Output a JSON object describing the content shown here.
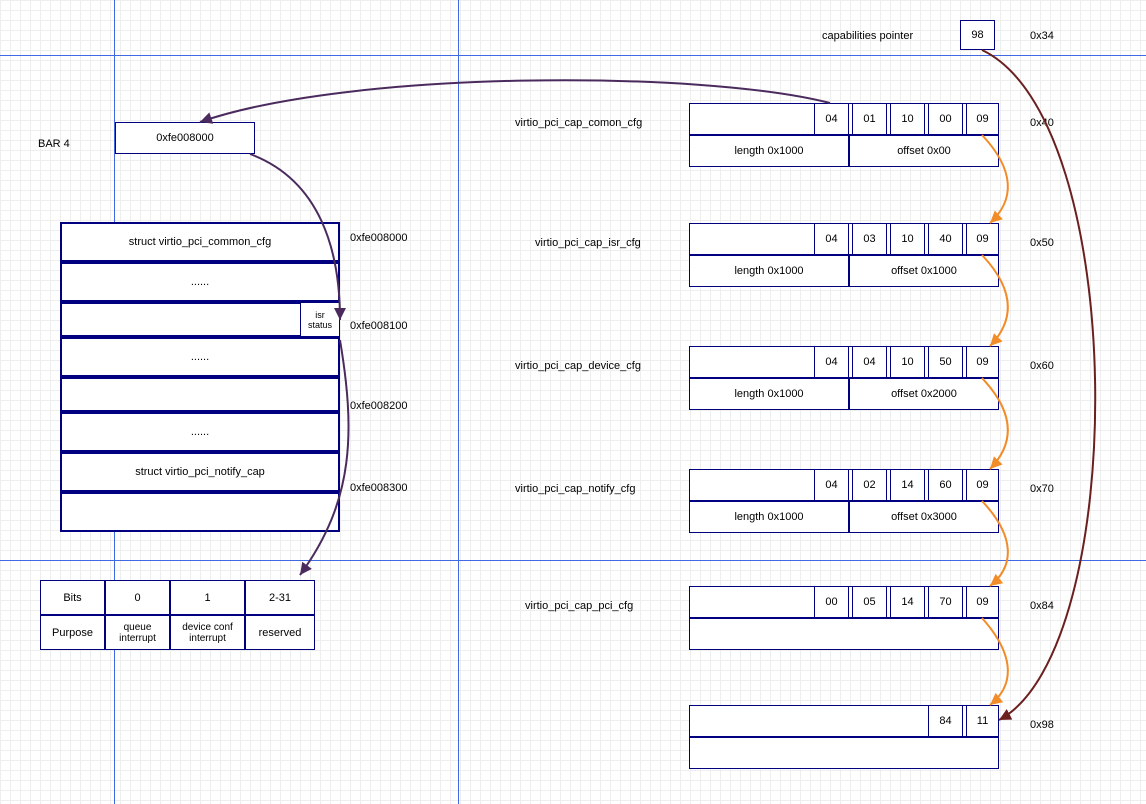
{
  "axes": {
    "h1": 55,
    "h2": 560,
    "v1": 114,
    "v2": 458
  },
  "cap_ptr": {
    "label": "capabilities pointer",
    "value": "98",
    "addr": "0x34"
  },
  "bar4": {
    "label": "BAR 4",
    "value": "0xfe008000"
  },
  "struct_rows": [
    {
      "text": "struct virtio_pci_common_cfg",
      "addr": "0xfe008000"
    },
    {
      "text": "......",
      "addr": ""
    },
    {
      "text": "",
      "addr": "0xfe008100",
      "isr": "isr status"
    },
    {
      "text": "......",
      "addr": ""
    },
    {
      "text": "",
      "addr": "0xfe008200"
    },
    {
      "text": "......",
      "addr": ""
    },
    {
      "text": "struct virtio_pci_notify_cap",
      "addr": "0xfe008300"
    },
    {
      "text": "",
      "addr": ""
    }
  ],
  "bits_table": {
    "headers": [
      "Bits",
      "0",
      "1",
      "2-31"
    ],
    "row": [
      "Purpose",
      "queue interrupt",
      "device conf interrupt",
      "reserved"
    ]
  },
  "caps": [
    {
      "label": "virtio_pci_cap_comon_cfg",
      "addr": "0x40",
      "cells": [
        "04",
        "01",
        "10",
        "00",
        "09"
      ],
      "length": "length 0x1000",
      "offset": "offset 0x00"
    },
    {
      "label": "virtio_pci_cap_isr_cfg",
      "addr": "0x50",
      "cells": [
        "04",
        "03",
        "10",
        "40",
        "09"
      ],
      "length": "length 0x1000",
      "offset": "offset 0x1000"
    },
    {
      "label": "virtio_pci_cap_device_cfg",
      "addr": "0x60",
      "cells": [
        "04",
        "04",
        "10",
        "50",
        "09"
      ],
      "length": "length 0x1000",
      "offset": "offset 0x2000"
    },
    {
      "label": "virtio_pci_cap_notify_cfg",
      "addr": "0x70",
      "cells": [
        "04",
        "02",
        "14",
        "60",
        "09"
      ],
      "length": "length 0x1000",
      "offset": "offset 0x3000"
    },
    {
      "label": "virtio_pci_cap_pci_cfg",
      "addr": "0x84",
      "cells": [
        "00",
        "05",
        "14",
        "70",
        "09"
      ],
      "length": "",
      "offset": ""
    }
  ],
  "last_cap": {
    "addr": "0x98",
    "cells": [
      "84",
      "11"
    ]
  }
}
